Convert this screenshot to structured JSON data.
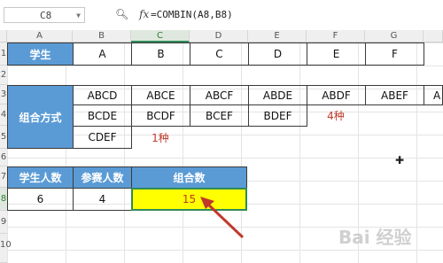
{
  "formula_bar": {
    "name_box": "C8",
    "zoom_icon": "magnify-icon",
    "fx_label": "fx",
    "formula": "=COMBIN(A8,B8)"
  },
  "columns": [
    "A",
    "B",
    "C",
    "D",
    "E",
    "F",
    "G"
  ],
  "active_column": "C",
  "rows": [
    "1",
    "2",
    "3",
    "4",
    "5",
    "6",
    "7",
    "8",
    "9",
    "10"
  ],
  "active_row": "8",
  "header_row": {
    "student_label": "学生",
    "students": [
      "A",
      "B",
      "C",
      "D",
      "E",
      "F"
    ]
  },
  "combinations": {
    "label": "组合方式",
    "row3": [
      "ABCD",
      "ABCE",
      "ABCF",
      "ABDE",
      "ABDF",
      "ABEF",
      "A"
    ],
    "row4": [
      "BCDE",
      "BCDF",
      "BCEF",
      "BDEF"
    ],
    "row4_note": "4种",
    "row5": [
      "CDEF"
    ],
    "row5_note": "1种"
  },
  "summary": {
    "students_header": "学生人数",
    "participants_header": "参赛人数",
    "combos_header": "组合数",
    "students_value": "6",
    "participants_value": "4",
    "combos_value": "15"
  },
  "watermark": "Bai 经验",
  "colors": {
    "header_blue": "#5b9bd5",
    "highlight_yellow": "#ffff00",
    "annotation_red": "#c0392b"
  }
}
